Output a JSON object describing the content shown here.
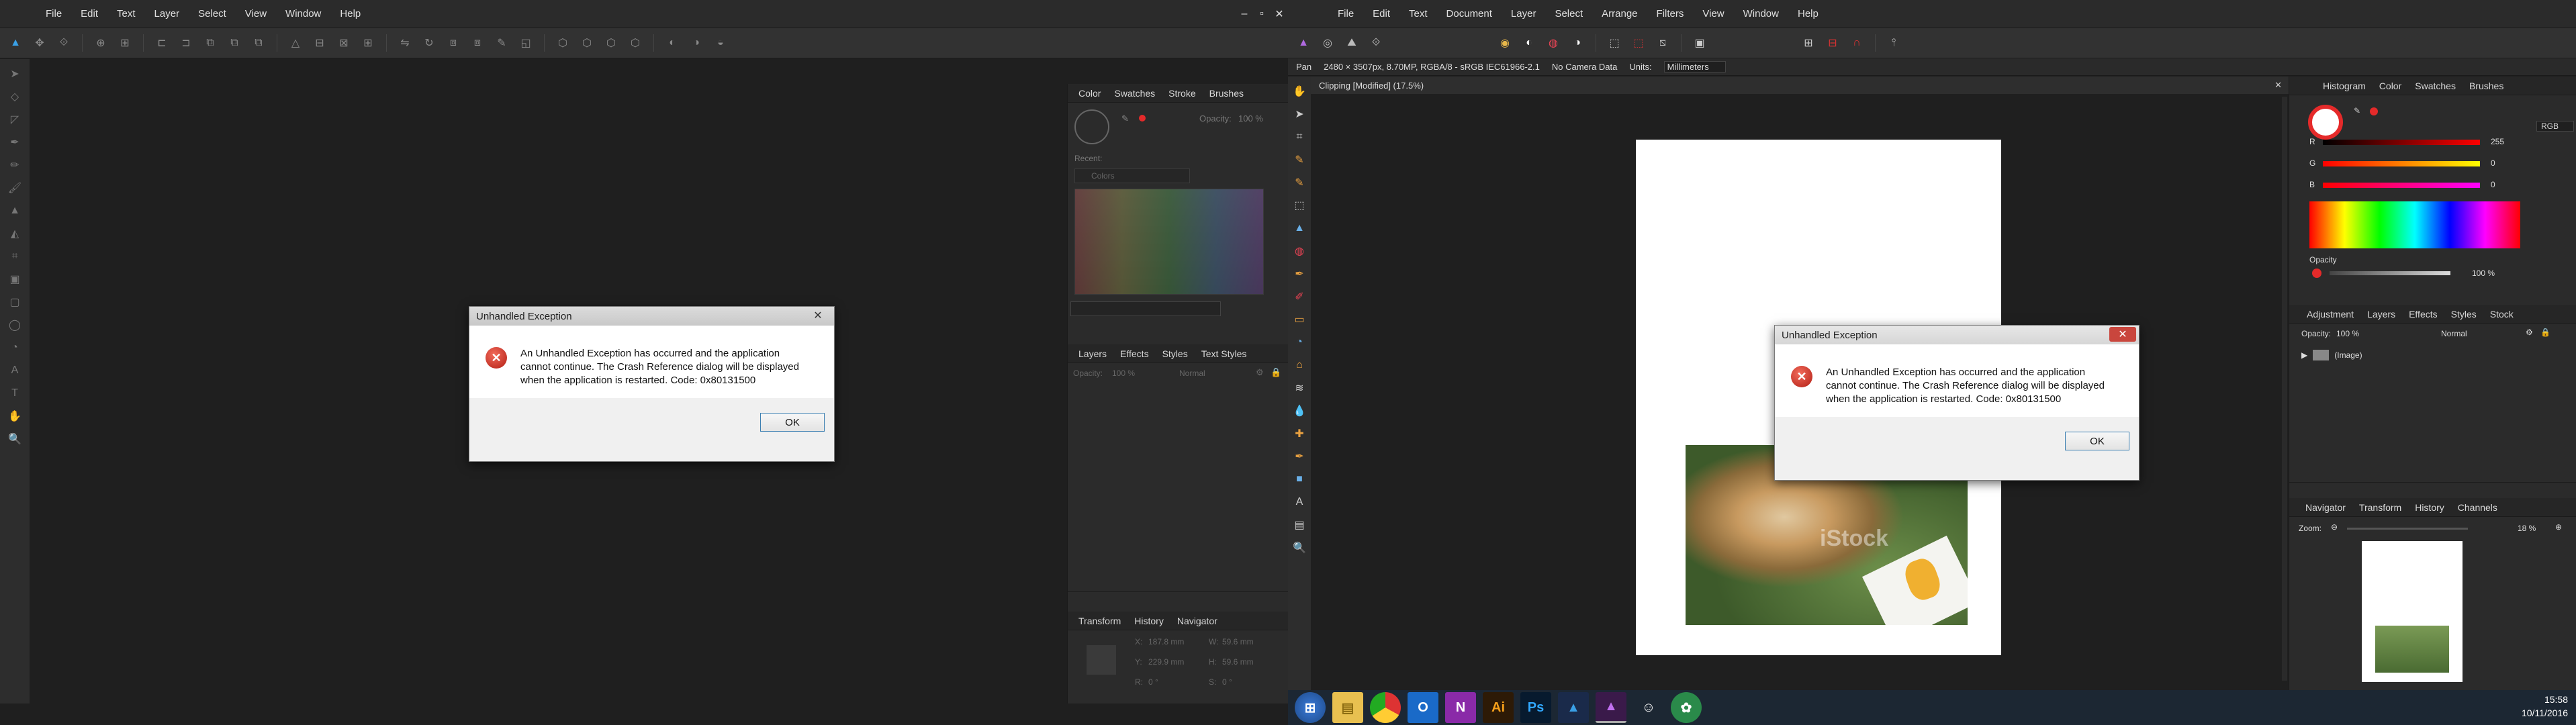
{
  "left": {
    "menu": [
      "File",
      "Edit",
      "Text",
      "Layer",
      "Select",
      "View",
      "Window",
      "Help"
    ],
    "win_controls": [
      "–",
      "▫",
      "✕"
    ],
    "color_panel_tabs": [
      "Color",
      "Swatches",
      "Stroke",
      "Brushes"
    ],
    "opacity_label": "Opacity:",
    "opacity_value": "100 %",
    "recent_label": "Recent:",
    "palette_name": "Colors",
    "layers_tabs": [
      "Layers",
      "Effects",
      "Styles",
      "Text Styles"
    ],
    "layers_opacity_label": "Opacity:",
    "layers_opacity_value": "100 %",
    "blend_mode": "Normal",
    "transform_tabs": [
      "Transform",
      "History",
      "Navigator"
    ],
    "transform": {
      "x_label": "X:",
      "x_value": "187.8 mm",
      "y_label": "Y:",
      "y_value": "229.9 mm",
      "w_label": "W:",
      "w_value": "59.6 mm",
      "h_label": "H:",
      "h_value": "59.6 mm",
      "r_label": "R:",
      "r_value": "0 °",
      "s_label": "S:",
      "s_value": "0 °"
    },
    "dialog": {
      "title": "Unhandled Exception",
      "close": "✕",
      "line1": "An Unhandled Exception has occurred and the application",
      "line2": "cannot continue. The Crash Reference dialog will be displayed",
      "line3": "when the application is restarted. Code: 0x80131500",
      "ok": "OK"
    }
  },
  "right": {
    "menu": [
      "File",
      "Edit",
      "Text",
      "Document",
      "Layer",
      "Select",
      "Arrange",
      "Filters",
      "View",
      "Window",
      "Help"
    ],
    "context": {
      "tool": "Pan",
      "info": "2480 × 3507px, 8.70MP, RGBA/8 - sRGB IEC61966-2.1",
      "camera": "No Camera Data",
      "units_label": "Units:",
      "units_value": "Millimeters"
    },
    "doc_tab": "Clipping [Modified] (17.5%)",
    "watermark": "iStock",
    "top_panel_tabs": [
      "Histogram",
      "Color",
      "Swatches",
      "Brushes"
    ],
    "color_model": "RGB",
    "r_label": "R",
    "r_value": "255",
    "g_label": "G",
    "g_value": "0",
    "b_label": "B",
    "b_value": "0",
    "opacity_label": "Opacity",
    "opacity_value": "100 %",
    "layers_tabs": [
      "Adjustment",
      "Layers",
      "Effects",
      "Styles",
      "Stock"
    ],
    "layers_opacity_label": "Opacity:",
    "layers_opacity_value": "100 %",
    "blend_mode": "Normal",
    "layer_name": "(Image)",
    "nav_tabs": [
      "Navigator",
      "Transform",
      "History",
      "Channels"
    ],
    "zoom_label": "Zoom:",
    "zoom_value": "18 %",
    "dialog": {
      "title": "Unhandled Exception",
      "close": "✕",
      "line1": "An Unhandled Exception has occurred and the application",
      "line2": "cannot continue. The Crash Reference dialog will be displayed",
      "line3": "when the application is restarted. Code: 0x80131500",
      "ok": "OK"
    }
  },
  "taskbar": {
    "apps": [
      "Ai",
      "Ps"
    ],
    "time": "15:58",
    "date": "10/11/2016"
  },
  "colors": {
    "accent_red": "#e52a2a",
    "canvas_bg": "#1f1f1f",
    "taskbar": "#1c2733"
  }
}
